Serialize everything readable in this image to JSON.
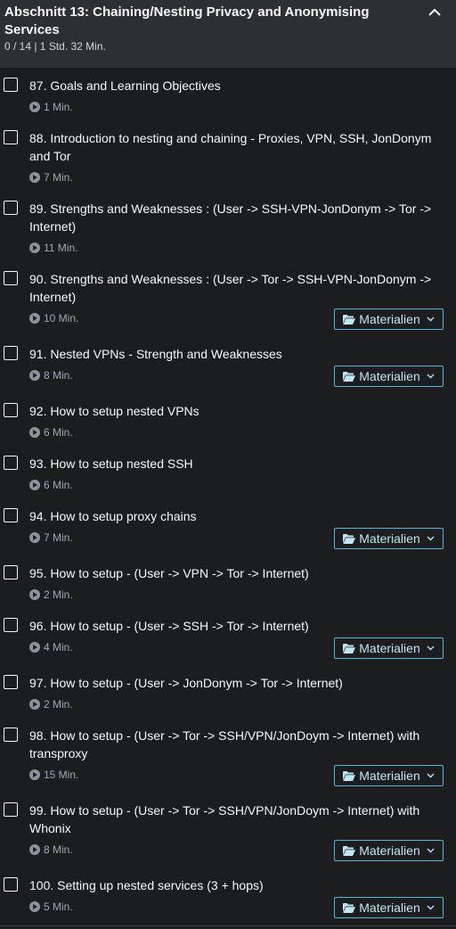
{
  "section": {
    "title": "Abschnitt 13: Chaining/Nesting Privacy and Anonymising Services",
    "meta": "0 / 14 | 1 Std. 32 Min."
  },
  "icons": {
    "collapse": "chevron-up-icon",
    "duration": "play-circle-icon",
    "resources": "folder-open-icon",
    "dropdown": "chevron-down-icon"
  },
  "colors": {
    "header_bg": "#2d2f31",
    "body_bg": "#1c1d1f",
    "resource_accent": "#4fb7dd"
  },
  "lectures": [
    {
      "title": "87. Goals and Learning Objectives",
      "duration": "1 Min.",
      "resources": null
    },
    {
      "title": "88. Introduction to nesting and chaining - Proxies, VPN, SSH, JonDonym and Tor",
      "duration": "7 Min.",
      "resources": null
    },
    {
      "title": "89. Strengths and Weaknesses : (User -> SSH-VPN-JonDonym -> Tor -> Internet)",
      "duration": "11 Min.",
      "resources": null
    },
    {
      "title": "90. Strengths and Weaknesses : (User -> Tor -> SSH-VPN-JonDonym -> Internet)",
      "duration": "10 Min.",
      "resources": "Materialien"
    },
    {
      "title": "91. Nested VPNs - Strength and Weaknesses",
      "duration": "8 Min.",
      "resources": "Materialien"
    },
    {
      "title": "92. How to setup nested VPNs",
      "duration": "6 Min.",
      "resources": null
    },
    {
      "title": "93. How to setup nested SSH",
      "duration": "6 Min.",
      "resources": null
    },
    {
      "title": "94. How to setup proxy chains",
      "duration": "7 Min.",
      "resources": "Materialien"
    },
    {
      "title": "95. How to setup - (User -> VPN -> Tor -> Internet)",
      "duration": "2 Min.",
      "resources": null
    },
    {
      "title": "96. How to setup - (User -> SSH -> Tor -> Internet)",
      "duration": "4 Min.",
      "resources": "Materialien"
    },
    {
      "title": "97. How to setup - (User -> JonDonym -> Tor -> Internet)",
      "duration": "2 Min.",
      "resources": null
    },
    {
      "title": "98. How to setup - (User -> Tor -> SSH/VPN/JonDoym -> Internet) with transproxy",
      "duration": "15 Min.",
      "resources": "Materialien"
    },
    {
      "title": "99. How to setup - (User -> Tor -> SSH/VPN/JonDoym -> Internet) with Whonix",
      "duration": "8 Min.",
      "resources": "Materialien"
    },
    {
      "title": "100. Setting up nested services (3 + hops)",
      "duration": "5 Min.",
      "resources": "Materialien"
    }
  ]
}
